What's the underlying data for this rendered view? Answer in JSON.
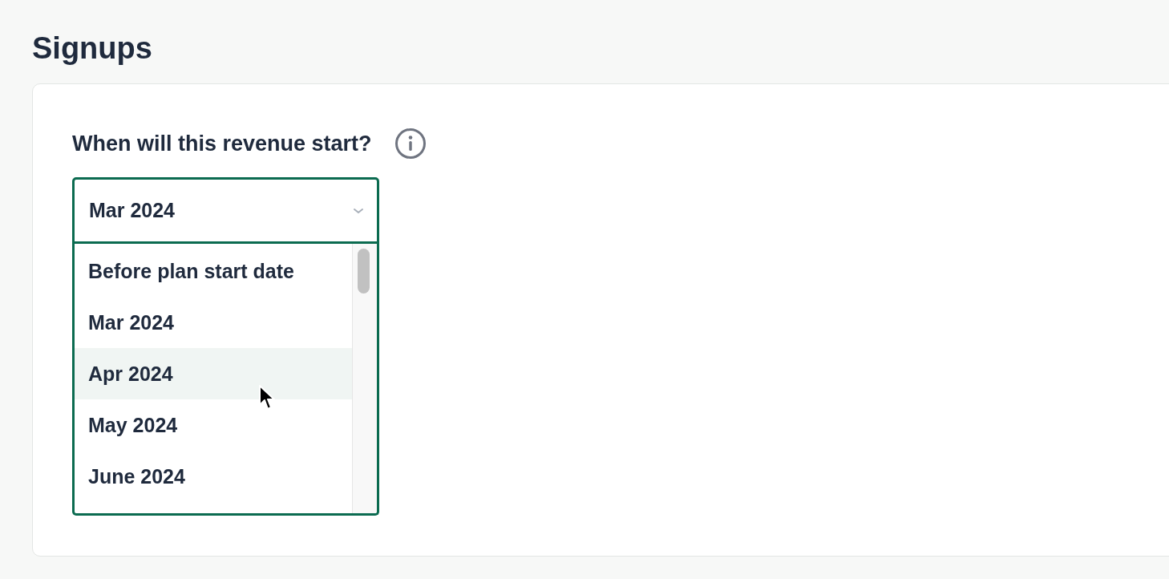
{
  "page": {
    "title": "Signups"
  },
  "question": {
    "label": "When will this revenue start?"
  },
  "select": {
    "value": "Mar 2024",
    "expanded": true,
    "options": [
      {
        "label": "Before plan start date",
        "highlighted": false
      },
      {
        "label": "Mar 2024",
        "highlighted": false
      },
      {
        "label": "Apr 2024",
        "highlighted": true
      },
      {
        "label": "May 2024",
        "highlighted": false
      },
      {
        "label": "June 2024",
        "highlighted": false
      }
    ]
  }
}
